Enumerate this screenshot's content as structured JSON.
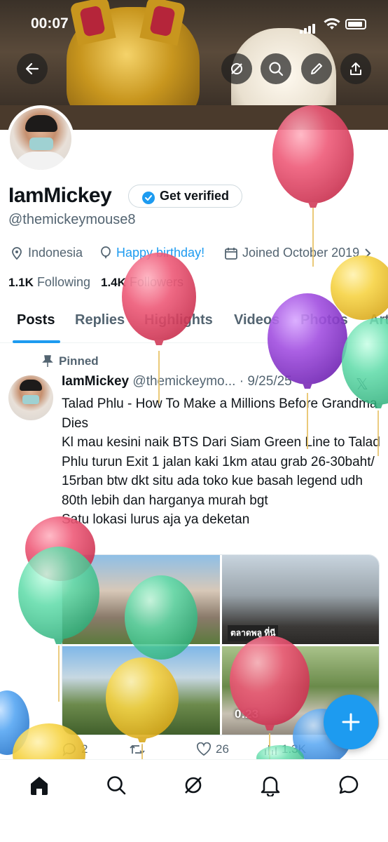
{
  "status_bar": {
    "time": "00:07"
  },
  "profile": {
    "name": "IamMickey",
    "verify_label": "Get verified",
    "handle": "@themickeymouse8",
    "location": "Indonesia",
    "birthday": "Happy birthday!",
    "joined": "Joined October 2019",
    "following_count": "1.1K",
    "following_label": "Following",
    "followers_count": "1.4K",
    "followers_label": "Followers"
  },
  "tabs": [
    {
      "label": "Posts"
    },
    {
      "label": "Replies"
    },
    {
      "label": "Highlights"
    },
    {
      "label": "Videos"
    },
    {
      "label": "Photos"
    },
    {
      "label": "Art"
    }
  ],
  "tweet": {
    "pinned_label": "Pinned",
    "author": "IamMickey",
    "handle_date": "@themickeymo... · 9/25/25",
    "text": [
      "Talad Phlu - How To Make a Millions Before Grandma Dies",
      "Kl mau kesini naik BTS Dari Siam Green Line to Talad Phlu turun Exit 1 jalan kaki 1km atau grab 26-30baht/ 15rban btw dkt situ ada toko kue basah legend udh 80th lebih dan harganya murah bgt",
      "Satu lokasi lurus aja ya deketan"
    ],
    "media_sign_text": "ตลาดพลู ที่นี",
    "video_time": "0:23",
    "reply_count": "2",
    "like_count": "26",
    "view_count": "1.3K"
  },
  "icons": {
    "back": "arrow-left-icon",
    "grok": "grok-icon",
    "search": "search-icon",
    "edit": "pencil-icon",
    "share": "share-icon",
    "verified": "verified-badge-icon",
    "location": "location-pin-icon",
    "birthday": "balloon-icon",
    "calendar": "calendar-icon",
    "pin": "pin-icon",
    "x_logo": "x-logo-icon",
    "reply": "reply-icon",
    "retweet": "retweet-icon",
    "like": "heart-icon",
    "views": "views-icon",
    "home": "home-icon",
    "explore": "search-icon",
    "notifications": "bell-icon",
    "messages": "message-icon",
    "compose": "plus-icon"
  },
  "colors": {
    "accent": "#1d9bf0",
    "text": "#0f1419",
    "muted": "#536471",
    "balloon_red": "#e8506c",
    "balloon_yellow": "#f4cd3c",
    "balloon_purple": "#9a45d6",
    "balloon_green": "#4fd6a0",
    "balloon_blue": "#4a9ff0"
  }
}
